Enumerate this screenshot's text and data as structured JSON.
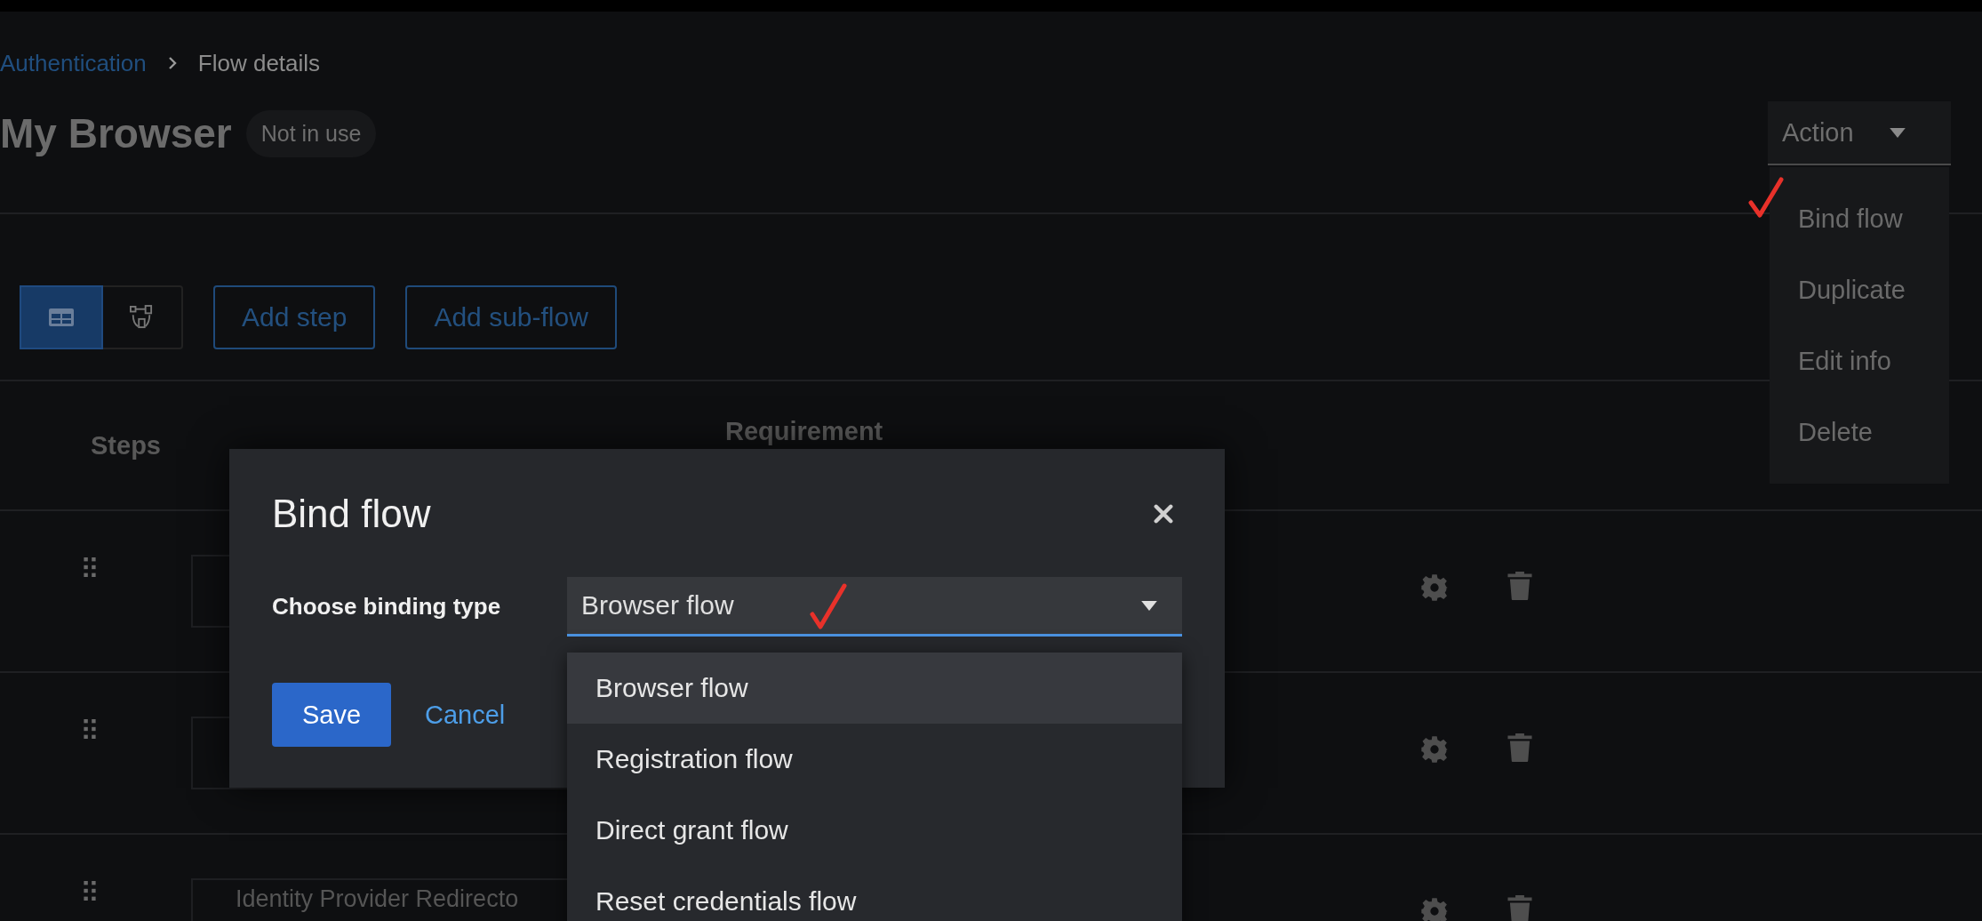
{
  "breadcrumb": [
    {
      "label": "Authentication",
      "kind": "link"
    },
    {
      "label": "Flow details",
      "kind": "current"
    }
  ],
  "page": {
    "title": "My Browser",
    "badge": "Not in use"
  },
  "action_menu": {
    "label": "Action",
    "expanded": true,
    "items": [
      "Bind flow",
      "Duplicate",
      "Edit info",
      "Delete"
    ]
  },
  "view_toggle": [
    {
      "kind": "table",
      "selected": true
    },
    {
      "kind": "diagram",
      "selected": false
    }
  ],
  "toolbar_buttons": [
    "Add step",
    "Add sub-flow"
  ],
  "table": {
    "columns": [
      "Steps",
      "Requirement"
    ],
    "rows": [
      {
        "kind": "step"
      },
      {
        "kind": "step"
      },
      {
        "kind": "step",
        "name": "Identity Provider Redirecto"
      }
    ]
  },
  "dialog": {
    "title": "Bind flow",
    "field_label": "Choose binding type",
    "value": "Browser flow",
    "expanded": true,
    "options": [
      {
        "label": "Browser flow",
        "selected": true
      },
      {
        "label": "Registration flow",
        "selected": false
      },
      {
        "label": "Direct grant flow",
        "selected": false
      },
      {
        "label": "Reset credentials flow",
        "selected": false
      }
    ],
    "buttons": [
      {
        "label": "Save",
        "kind": "primary"
      },
      {
        "label": "Cancel",
        "kind": "link"
      }
    ]
  }
}
